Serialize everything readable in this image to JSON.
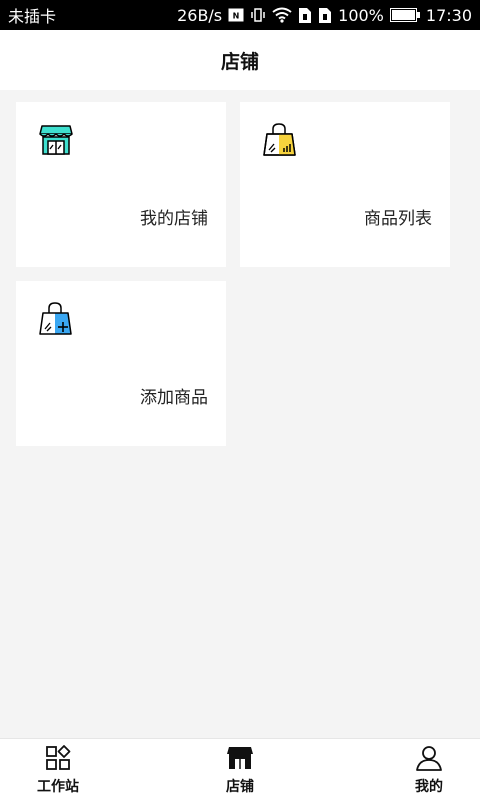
{
  "status_bar": {
    "carrier": "未插卡",
    "speed": "26B/s",
    "battery": "100%",
    "time": "17:30",
    "icons": [
      "nfc-icon",
      "vibrate-icon",
      "wifi-icon",
      "sim1-icon",
      "sim2-icon",
      "battery-icon"
    ]
  },
  "header": {
    "title": "店铺"
  },
  "cards": [
    {
      "label": "我的店铺",
      "icon": "store-icon",
      "color": "#3fe0cf"
    },
    {
      "label": "商品列表",
      "icon": "shopping-bag-list-icon",
      "color": "#f7d33d"
    },
    {
      "label": "添加商品",
      "icon": "shopping-bag-add-icon",
      "color": "#3aa7f2"
    }
  ],
  "tab_bar": {
    "items": [
      {
        "label": "工作站",
        "icon": "grid-shapes-icon"
      },
      {
        "label": "店铺",
        "icon": "store-icon"
      },
      {
        "label": "我的",
        "icon": "user-icon"
      }
    ]
  }
}
